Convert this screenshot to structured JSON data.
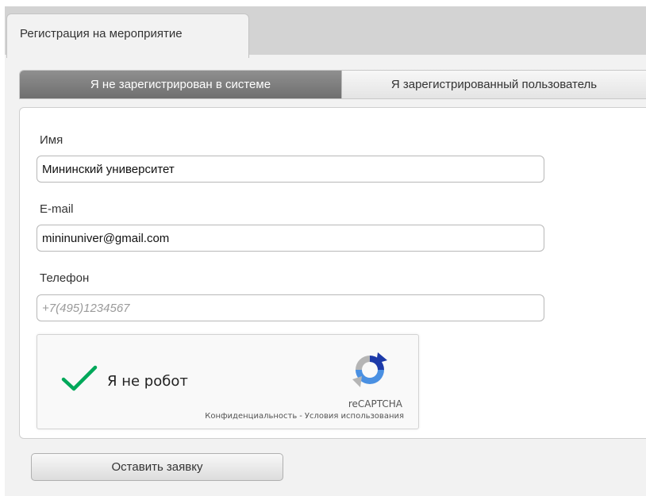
{
  "tabs": [
    {
      "label": "Регистрация на мероприятие",
      "active": true
    }
  ],
  "auth_toggle": {
    "not_registered": "Я не зарегистрирован в системе",
    "registered": "Я зарегистрированный пользователь",
    "selected": "not_registered"
  },
  "form": {
    "name": {
      "label": "Имя",
      "value": "Мининский университет"
    },
    "email": {
      "label": "E-mail",
      "value": "mininuniver@gmail.com"
    },
    "phone": {
      "label": "Телефон",
      "value": "",
      "placeholder": "+7(495)1234567"
    }
  },
  "captcha": {
    "label": "Я не робот",
    "brand": "reCAPTCHA",
    "privacy": "Конфиденциальность",
    "separator": "-",
    "terms": "Условия использования",
    "checked": true
  },
  "submit_label": "Оставить заявку",
  "colors": {
    "toggle_active": "#7f7f7f",
    "check_green": "#00a85a"
  }
}
